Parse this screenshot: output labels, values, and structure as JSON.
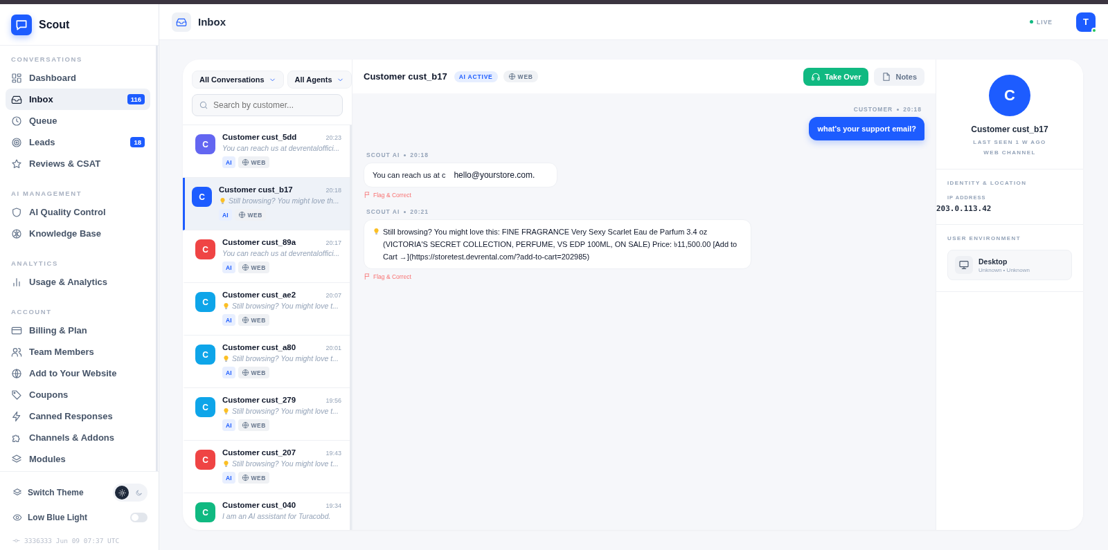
{
  "brand": {
    "name": "Scout"
  },
  "sidebar": {
    "sections": [
      {
        "title": "CONVERSATIONS",
        "items": [
          {
            "label": "Dashboard",
            "selected": false
          },
          {
            "label": "Inbox",
            "selected": true,
            "badge": "116"
          },
          {
            "label": "Queue",
            "selected": false
          },
          {
            "label": "Leads",
            "selected": false,
            "badge": "18"
          },
          {
            "label": "Reviews & CSAT",
            "selected": false
          }
        ]
      },
      {
        "title": "AI MANAGEMENT",
        "items": [
          {
            "label": "AI Quality Control",
            "selected": false
          },
          {
            "label": "Knowledge Base",
            "selected": false
          }
        ]
      },
      {
        "title": "ANALYTICS",
        "items": [
          {
            "label": "Usage & Analytics",
            "selected": false
          }
        ]
      },
      {
        "title": "ACCOUNT",
        "items": [
          {
            "label": "Billing & Plan",
            "selected": false
          },
          {
            "label": "Team Members",
            "selected": false
          },
          {
            "label": "Add to Your Website",
            "selected": false
          },
          {
            "label": "Coupons",
            "selected": false
          },
          {
            "label": "Canned Responses",
            "selected": false
          },
          {
            "label": "Channels & Addons",
            "selected": false
          },
          {
            "label": "Modules",
            "selected": false
          }
        ]
      }
    ],
    "theme": {
      "label": "Switch Theme",
      "dark": false
    },
    "low_blue_light": {
      "label": "Low Blue Light",
      "on": false
    },
    "build": "3336333 Jun 09 07:37 UTC"
  },
  "header": {
    "title": "Inbox",
    "status": "LIVE",
    "user_initial": "T"
  },
  "filters": [
    {
      "label": "All Conversations"
    },
    {
      "label": "All Agents"
    }
  ],
  "search": {
    "placeholder": "Search by customer..."
  },
  "conversations": [
    {
      "initial": "C",
      "name": "Customer cust_5dd",
      "time": "20:23",
      "preview": "You can reach us at devrentaloffici...",
      "bulb": false,
      "color": "#6366f1",
      "selected": false,
      "tags": [
        "AI",
        "WEB"
      ]
    },
    {
      "initial": "C",
      "name": "Customer cust_b17",
      "time": "20:18",
      "preview": "Still browsing? You might love th...",
      "bulb": true,
      "color": "#1d5cff",
      "selected": true,
      "tags": [
        "AI",
        "WEB"
      ]
    },
    {
      "initial": "C",
      "name": "Customer cust_89a",
      "time": "20:17",
      "preview": "You can reach us at devrentaloffici...",
      "bulb": false,
      "color": "#ef4444",
      "selected": false,
      "tags": [
        "AI",
        "WEB"
      ]
    },
    {
      "initial": "C",
      "name": "Customer cust_ae2",
      "time": "20:07",
      "preview": "Still browsing? You might love t...",
      "bulb": true,
      "color": "#0ea5e9",
      "selected": false,
      "tags": [
        "AI",
        "WEB"
      ]
    },
    {
      "initial": "C",
      "name": "Customer cust_a80",
      "time": "20:01",
      "preview": "Still browsing? You might love t...",
      "bulb": true,
      "color": "#0ea5e9",
      "selected": false,
      "tags": [
        "AI",
        "WEB"
      ]
    },
    {
      "initial": "C",
      "name": "Customer cust_279",
      "time": "19:56",
      "preview": "Still browsing? You might love t...",
      "bulb": true,
      "color": "#0ea5e9",
      "selected": false,
      "tags": [
        "AI",
        "WEB"
      ]
    },
    {
      "initial": "C",
      "name": "Customer cust_207",
      "time": "19:43",
      "preview": "Still browsing? You might love t...",
      "bulb": true,
      "color": "#ef4444",
      "selected": false,
      "tags": [
        "AI",
        "WEB"
      ]
    },
    {
      "initial": "C",
      "name": "Customer cust_040",
      "time": "19:34",
      "preview": "I am an AI assistant for Turacobd.",
      "bulb": false,
      "color": "#10b981",
      "selected": false
    }
  ],
  "chat": {
    "title": "Customer cust_b17",
    "status": "AI ACTIVE",
    "channel": "WEB",
    "buttons": [
      {
        "label": "Take Over",
        "kind": "primary"
      },
      {
        "label": "Notes",
        "kind": "secondary"
      }
    ],
    "messages": [
      {
        "sender": "CUSTOMER",
        "time": "20:18",
        "kind": "customer",
        "bulb": false,
        "parts": [
          "what's your support email?"
        ]
      },
      {
        "sender": "SCOUT AI",
        "time": "20:18",
        "kind": "ai",
        "bulb": false,
        "parts": [
          "You can reach us at c",
          "hello@yourstore.com."
        ],
        "flag": "Flag & Correct"
      },
      {
        "sender": "SCOUT AI",
        "time": "20:21",
        "kind": "ai",
        "bulb": true,
        "parts": [
          "Still browsing? You might love this: FINE FRAGRANCE Very Sexy Scarlet Eau de Parfum 3.4 oz (VICTORIA'S SECRET COLLECTION, PERFUME, VS EDP 100ML, ON SALE) Price: ৳11,500.00 [Add to Cart →](https://storetest.devrental.com/?add-to-cart=202985)"
        ],
        "flag": "Flag & Correct"
      }
    ]
  },
  "profile": {
    "initial": "C",
    "name": "Customer cust_b17",
    "last_seen": "LAST SEEN 1 W AGO",
    "channel": "WEB CHANNEL",
    "identity_title": "IDENTITY & LOCATION",
    "ip_label": "IP ADDRESS",
    "ip": "203.0.113.42",
    "env_title": "USER ENVIRONMENT",
    "device": "Desktop",
    "device_detail": "Unknown • Unknown"
  }
}
